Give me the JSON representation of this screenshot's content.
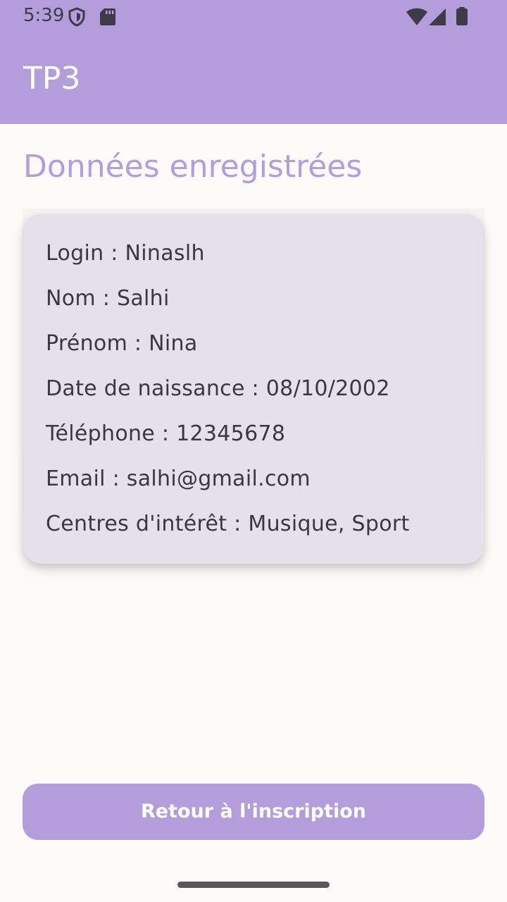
{
  "status_bar": {
    "time": "5:39"
  },
  "app_bar": {
    "title": "TP3"
  },
  "page": {
    "heading": "Données enregistrées"
  },
  "details": [
    {
      "text": "Login : Ninaslh"
    },
    {
      "text": "Nom : Salhi"
    },
    {
      "text": "Prénom : Nina"
    },
    {
      "text": "Date de naissance : 08/10/2002"
    },
    {
      "text": "Téléphone : 12345678"
    },
    {
      "text": "Email : salhi@gmail.com"
    },
    {
      "text": "Centres d'intérêt : Musique, Sport"
    }
  ],
  "actions": {
    "back_label": "Retour à l'inscription"
  },
  "colors": {
    "primary": "#b39ddb",
    "card": "#e6dfec",
    "background": "#fcfbf9",
    "text": "#3b3742"
  },
  "icons": [
    "shield-icon",
    "sd-card-icon",
    "wifi-icon",
    "cell-signal-icon",
    "battery-icon"
  ]
}
